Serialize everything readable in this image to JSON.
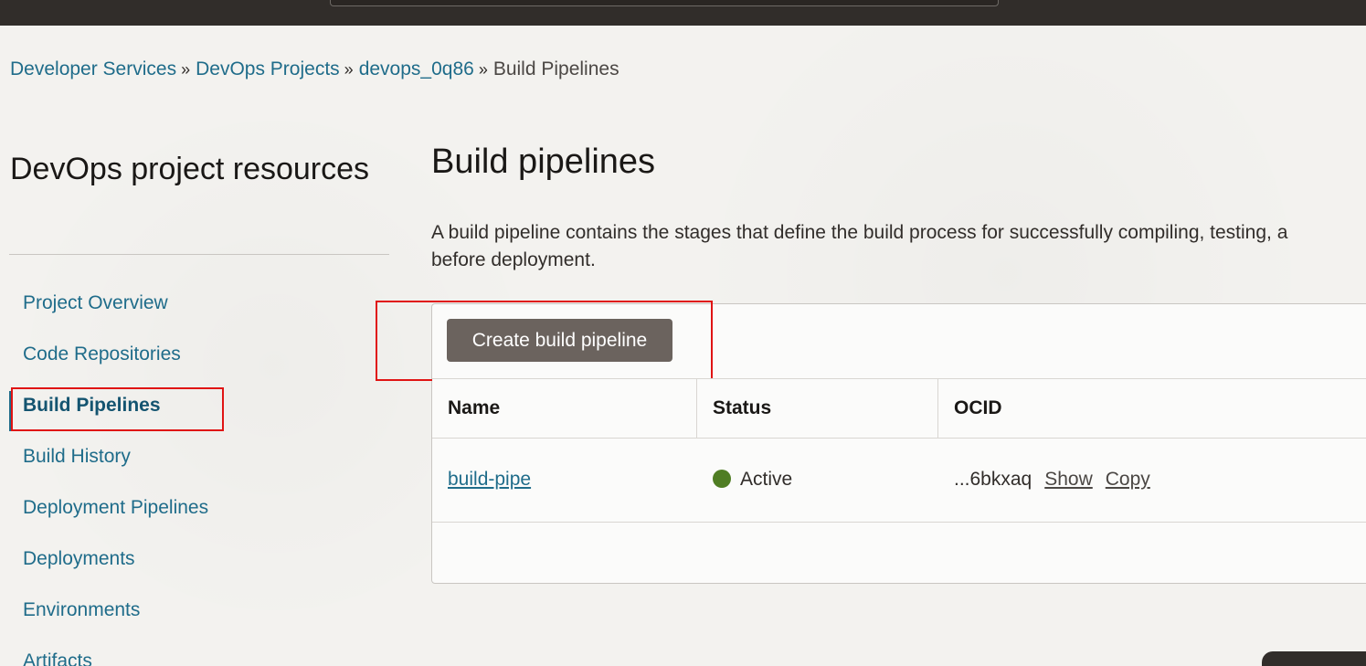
{
  "breadcrumb": {
    "items": [
      "Developer Services",
      "DevOps Projects",
      "devops_0q86"
    ],
    "current": "Build Pipelines",
    "separator": "»"
  },
  "sidebar": {
    "title": "DevOps project resources",
    "items": [
      {
        "label": "Project Overview"
      },
      {
        "label": "Code Repositories"
      },
      {
        "label": "Build Pipelines"
      },
      {
        "label": "Build History"
      },
      {
        "label": "Deployment Pipelines"
      },
      {
        "label": "Deployments"
      },
      {
        "label": "Environments"
      },
      {
        "label": "Artifacts"
      }
    ],
    "active_index": 2
  },
  "main": {
    "title": "Build pipelines",
    "description_line1": "A build pipeline contains the stages that define the build process for successfully compiling, testing, a",
    "description_line2": "before deployment.",
    "create_button_label": "Create build pipeline"
  },
  "table": {
    "columns": [
      "Name",
      "Status",
      "OCID"
    ],
    "rows": [
      {
        "name": "build-pipe",
        "status": "Active",
        "ocid": "...6bkxaq",
        "show_label": "Show",
        "copy_label": "Copy"
      }
    ]
  },
  "colors": {
    "accent_link": "#1f6c8a",
    "status_active": "#4f7d23",
    "button_bg": "#6b635e",
    "annotation_red": "#e01414"
  },
  "icons": {
    "status_active": "status-dot-icon",
    "breadcrumb_separator": "chevron-double-right-icon"
  }
}
